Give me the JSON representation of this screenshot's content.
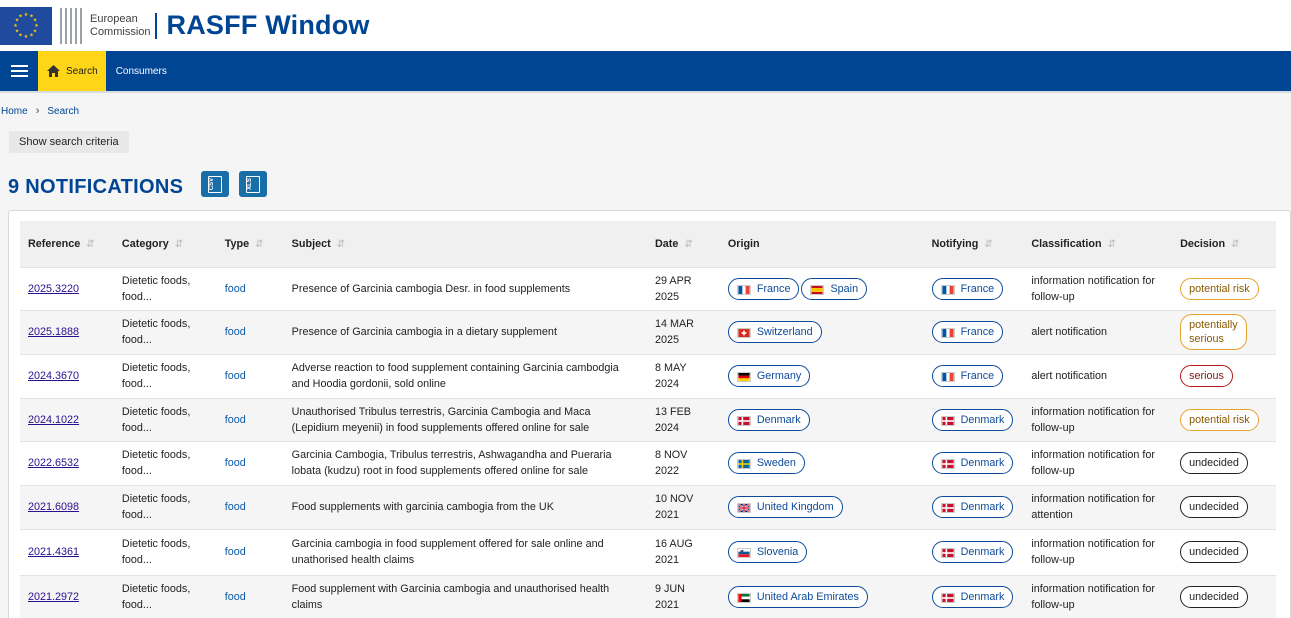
{
  "header": {
    "ec_line1": "European",
    "ec_line2": "Commission",
    "app_title": "RASFF Window"
  },
  "nav": {
    "search_label": "Search",
    "consumers_label": "Consumers"
  },
  "breadcrumb": {
    "home": "Home",
    "current": "Search"
  },
  "show_criteria_label": "Show search criteria",
  "notifications_title": "9 NOTIFICATIONS",
  "export": {
    "csv": "CSV",
    "xls": "XLS"
  },
  "table": {
    "headers": [
      "Reference",
      "Category",
      "Type",
      "Subject",
      "Date",
      "Origin",
      "Notifying",
      "Classification",
      "Decision"
    ],
    "rows": [
      {
        "reference": "2025.3220",
        "category": [
          "Dietetic foods,",
          "food..."
        ],
        "type": "food",
        "subject": "Presence of Garcinia cambogia Desr. in food supplements",
        "date": [
          "29 APR",
          "2025"
        ],
        "origin": [
          {
            "name": "France",
            "flag": "fr"
          },
          {
            "name": "Spain",
            "flag": "es"
          }
        ],
        "notifying": {
          "name": "France",
          "flag": "fr"
        },
        "classification": [
          "information notification for",
          "follow-up"
        ],
        "decision": [
          "potential risk"
        ],
        "decision_kind": "potential"
      },
      {
        "reference": "2025.1888",
        "category": [
          "Dietetic foods,",
          "food..."
        ],
        "type": "food",
        "subject": "Presence of Garcinia cambogia in a dietary supplement",
        "date": [
          "14 MAR",
          "2025"
        ],
        "origin": [
          {
            "name": "Switzerland",
            "flag": "ch"
          }
        ],
        "notifying": {
          "name": "France",
          "flag": "fr"
        },
        "classification": [
          "alert notification"
        ],
        "decision": [
          "potentially",
          "serious"
        ],
        "decision_kind": "potential"
      },
      {
        "reference": "2024.3670",
        "category": [
          "Dietetic foods,",
          "food..."
        ],
        "type": "food",
        "subject": "Adverse reaction to food supplement containing Garcinia cambodgia and Hoodia gordonii, sold online",
        "date": [
          "8 MAY 2024"
        ],
        "origin": [
          {
            "name": "Germany",
            "flag": "de"
          }
        ],
        "notifying": {
          "name": "France",
          "flag": "fr"
        },
        "classification": [
          "alert notification"
        ],
        "decision": [
          "serious"
        ],
        "decision_kind": "serious"
      },
      {
        "reference": "2024.1022",
        "category": [
          "Dietetic foods,",
          "food..."
        ],
        "type": "food",
        "subject": "Unauthorised Tribulus terrestris, Garcinia Cambogia and Maca (Lepidium meyenii) in food supplements offered online for sale",
        "date": [
          "13 FEB",
          "2024"
        ],
        "origin": [
          {
            "name": "Denmark",
            "flag": "dk"
          }
        ],
        "notifying": {
          "name": "Denmark",
          "flag": "dk"
        },
        "classification": [
          "information notification for",
          "follow-up"
        ],
        "decision": [
          "potential risk"
        ],
        "decision_kind": "potential"
      },
      {
        "reference": "2022.6532",
        "category": [
          "Dietetic foods,",
          "food..."
        ],
        "type": "food",
        "subject": "Garcinia Cambogia, Tribulus terrestris, Ashwagandha and Pueraria lobata (kudzu) root in food supplements offered online for sale",
        "date": [
          "8 NOV",
          "2022"
        ],
        "origin": [
          {
            "name": "Sweden",
            "flag": "se"
          }
        ],
        "notifying": {
          "name": "Denmark",
          "flag": "dk"
        },
        "classification": [
          "information notification for",
          "follow-up"
        ],
        "decision": [
          "undecided"
        ],
        "decision_kind": "undecided"
      },
      {
        "reference": "2021.6098",
        "category": [
          "Dietetic foods,",
          "food..."
        ],
        "type": "food",
        "subject": "Food supplements with garcinia cambogia from the UK",
        "date": [
          "10 NOV",
          "2021"
        ],
        "origin": [
          {
            "name": "United Kingdom",
            "flag": "gb"
          }
        ],
        "notifying": {
          "name": "Denmark",
          "flag": "dk"
        },
        "classification": [
          "information notification for",
          "attention"
        ],
        "decision": [
          "undecided"
        ],
        "decision_kind": "undecided"
      },
      {
        "reference": "2021.4361",
        "category": [
          "Dietetic foods,",
          "food..."
        ],
        "type": "food",
        "subject": "Garcinia cambogia in food supplement offered for sale online and unathorised health claims",
        "date": [
          "16 AUG",
          "2021"
        ],
        "origin": [
          {
            "name": "Slovenia",
            "flag": "si"
          }
        ],
        "notifying": {
          "name": "Denmark",
          "flag": "dk"
        },
        "classification": [
          "information notification for",
          "follow-up"
        ],
        "decision": [
          "undecided"
        ],
        "decision_kind": "undecided"
      },
      {
        "reference": "2021.2972",
        "category": [
          "Dietetic foods,",
          "food..."
        ],
        "type": "food",
        "subject": "Food supplement with Garcinia cambogia and unauthorised health claims",
        "date": [
          "9 JUN 2021"
        ],
        "origin": [
          {
            "name": "United Arab Emirates",
            "flag": "ae"
          }
        ],
        "notifying": {
          "name": "Denmark",
          "flag": "dk"
        },
        "classification": [
          "information notification for",
          "follow-up"
        ],
        "decision": [
          "undecided"
        ],
        "decision_kind": "undecided"
      }
    ]
  },
  "colors": {
    "brand_blue": "#004494",
    "nav_active": "#ffd617",
    "link": "#2a0f8f"
  }
}
